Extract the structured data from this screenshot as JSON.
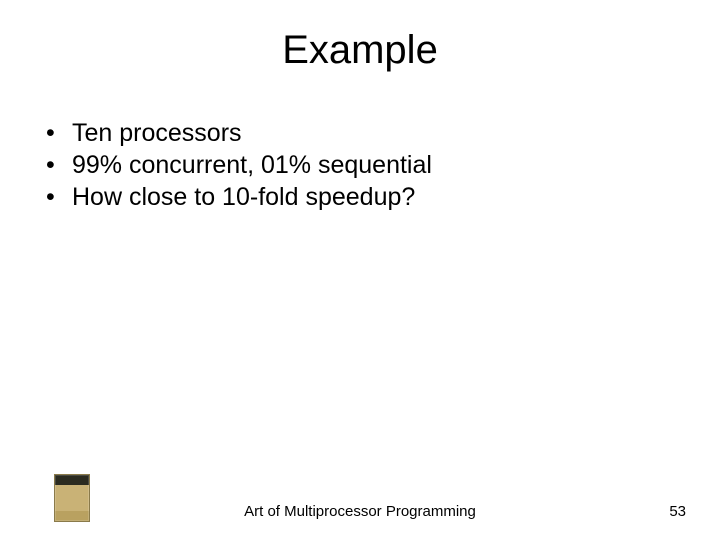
{
  "title": "Example",
  "bullets": [
    "Ten processors",
    "99% concurrent, 01% sequential",
    "How close to 10-fold speedup?"
  ],
  "footer": {
    "text": "Art of Multiprocessor Programming",
    "page": "53"
  }
}
